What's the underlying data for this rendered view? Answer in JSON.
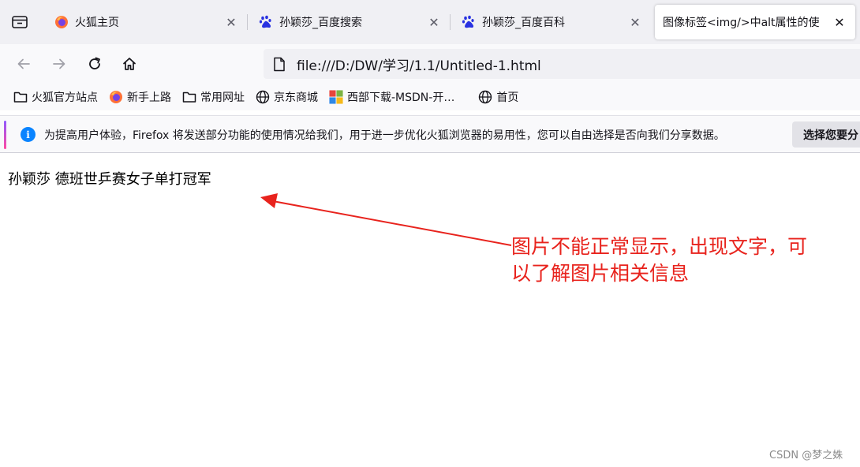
{
  "tabs": [
    {
      "title": "火狐主页",
      "icon": "firefox-icon",
      "active": false
    },
    {
      "title": "孙颖莎_百度搜索",
      "icon": "baidu-paw-icon",
      "active": false
    },
    {
      "title": "孙颖莎_百度百科",
      "icon": "baidu-paw-icon",
      "active": false
    },
    {
      "title": "图像标签<img/>中alt属性的使",
      "icon": "none",
      "active": true
    }
  ],
  "nav": {
    "url": "file:///D:/DW/学习/1.1/Untitled-1.html"
  },
  "bookmarks": [
    {
      "label": "火狐官方站点",
      "icon": "folder-icon"
    },
    {
      "label": "新手上路",
      "icon": "firefox-icon"
    },
    {
      "label": "常用网址",
      "icon": "folder-icon"
    },
    {
      "label": "京东商城",
      "icon": "globe-icon"
    },
    {
      "label": "西部下载-MSDN-开…",
      "icon": "windows-logo-icon"
    },
    {
      "label": "首页",
      "icon": "globe-icon"
    }
  ],
  "notification": {
    "message": "为提高用户体验，Firefox 将发送部分功能的使用情况给我们，用于进一步优化火狐浏览器的易用性，您可以自由选择是否向我们分享数据。",
    "button": "选择您要分"
  },
  "page": {
    "alt_text": "孙颖莎 德班世乒赛女子单打冠军",
    "annotation_line1": "图片不能正常显示，出现文字，可",
    "annotation_line2": "以了解图片相关信息",
    "watermark": "CSDN @梦之姝"
  },
  "colors": {
    "annotation": "#e8231d",
    "info": "#0a84ff",
    "firefox_orange": "#ff7139",
    "baidu_blue": "#2932e1"
  }
}
